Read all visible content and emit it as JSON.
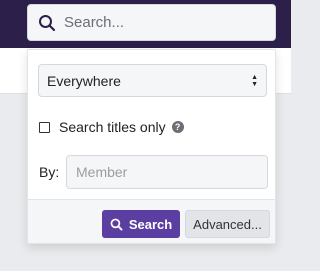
{
  "search": {
    "placeholder": "Search..."
  },
  "menu": {
    "scope": {
      "selected": "Everywhere"
    },
    "titles_only": {
      "label": "Search titles only",
      "checked": false,
      "help_icon": "question-circle-icon"
    },
    "by": {
      "label": "By:",
      "placeholder": "Member"
    },
    "footer": {
      "search_label": "Search",
      "advanced_label": "Advanced..."
    }
  },
  "colors": {
    "header": "#2c1f4a",
    "accent": "#5a3ea1"
  }
}
